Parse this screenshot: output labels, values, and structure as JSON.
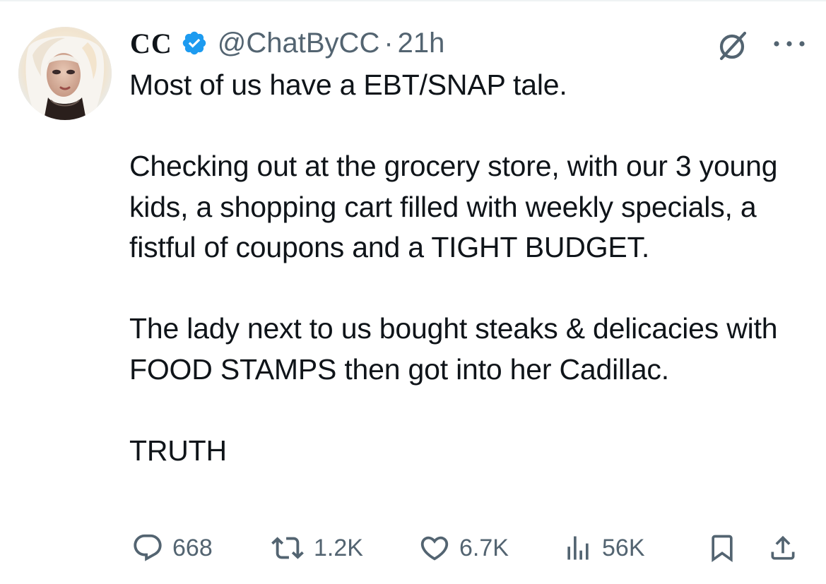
{
  "author": {
    "display_name": "CC",
    "verified": true,
    "handle": "@ChatByCC",
    "separator": "·",
    "time": "21h"
  },
  "tweet": {
    "text": "Most of us have a EBT/SNAP tale.\n\nChecking out at the grocery store, with our 3 young kids, a shopping cart filled with weekly specials, a fistful of coupons and a TIGHT BUDGET.\n\nThe lady next to us bought steaks & delicacies with   FOOD STAMPS then got into her Cadillac.\n\nTRUTH"
  },
  "actions": {
    "replies": "668",
    "reposts": "1.2K",
    "likes": "6.7K",
    "views": "56K"
  },
  "icons": {
    "header": [
      "verified-badge-icon",
      "grok-icon",
      "more-icon"
    ],
    "actions": [
      "reply-icon",
      "repost-icon",
      "like-icon",
      "views-icon",
      "bookmark-icon",
      "share-icon"
    ]
  },
  "colors": {
    "text_primary": "#0f1419",
    "text_secondary": "#536471",
    "verified_blue": "#1d9bf0"
  }
}
